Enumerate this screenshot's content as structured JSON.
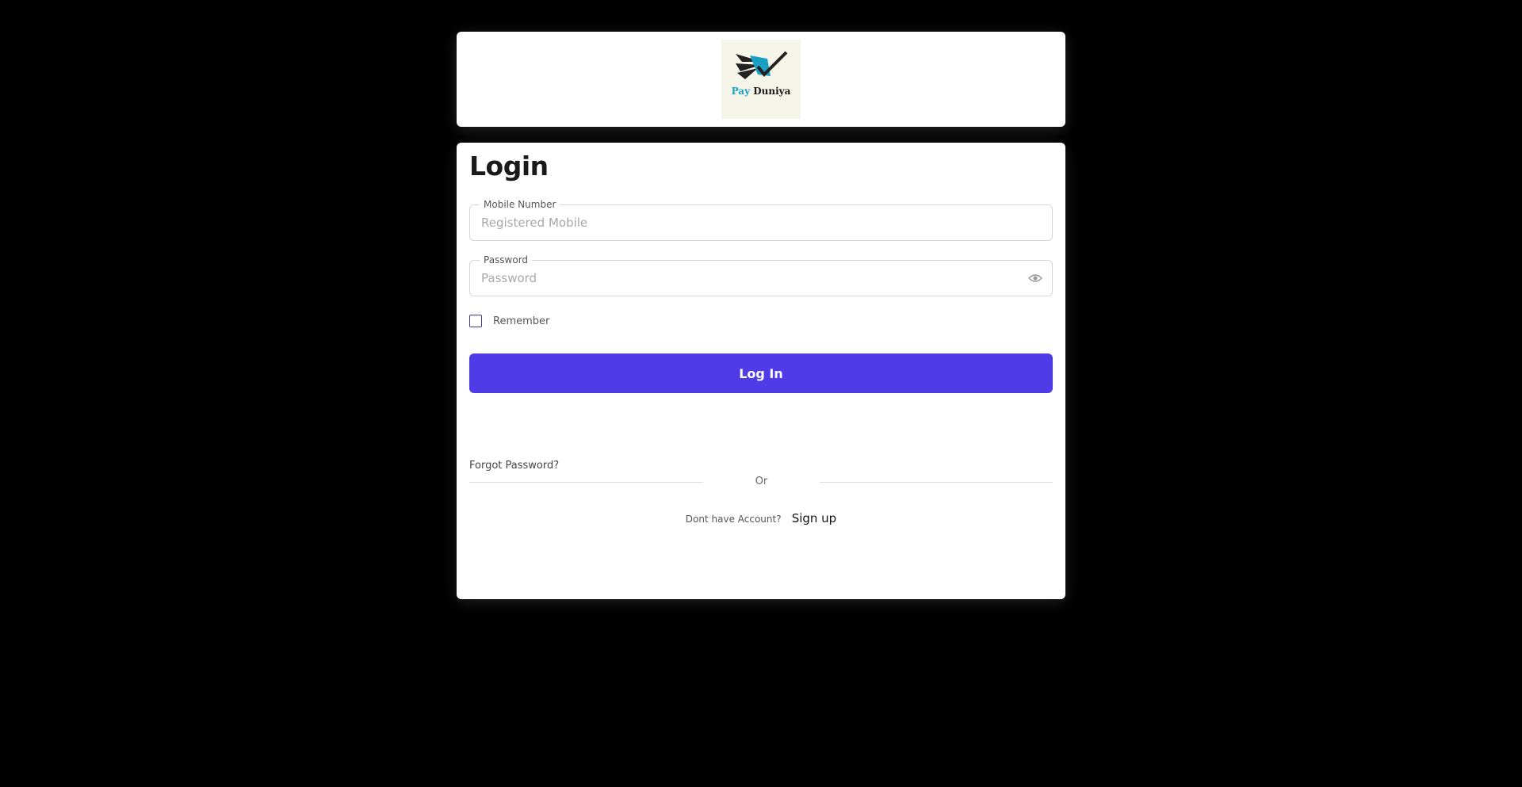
{
  "brand": {
    "logo_word_1": "Pay",
    "logo_word_2": "Duniya",
    "logo_icon": "paper-plane-check-icon",
    "logo_colors": {
      "dark": "#222222",
      "accent": "#1aa0c2",
      "background": "#f5f5e9"
    }
  },
  "login": {
    "title": "Login",
    "mobile": {
      "label": "Mobile Number",
      "placeholder": "Registered Mobile",
      "value": ""
    },
    "password": {
      "label": "Password",
      "placeholder": "Password",
      "value": "",
      "toggle_icon": "eye-icon"
    },
    "remember": {
      "label": "Remember",
      "checked": false
    },
    "submit_label": "Log In",
    "forgot_label": "Forgot Password?",
    "divider_label": "Or",
    "no_account_label": "Dont have Account?",
    "signup_label": "Sign up"
  },
  "colors": {
    "primary": "#4f3ce6",
    "page_background": "#000000",
    "card_background": "#ffffff"
  }
}
